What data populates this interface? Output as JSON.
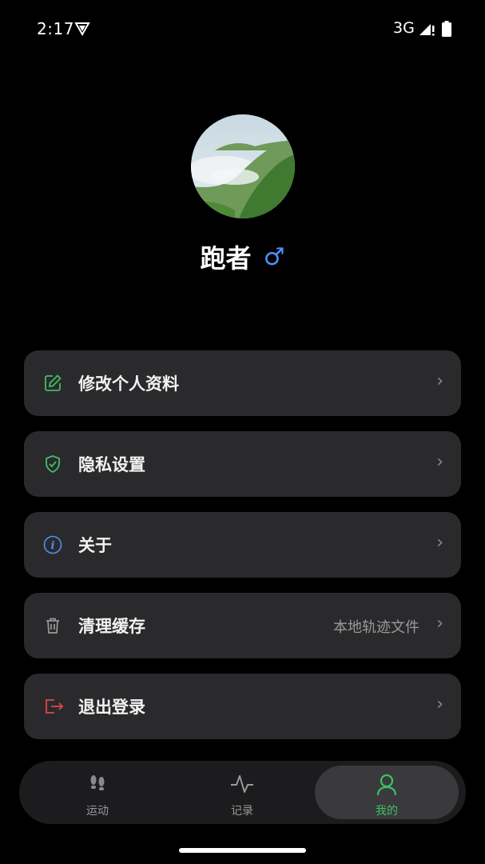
{
  "status_bar": {
    "time": "2:17",
    "network": "3G"
  },
  "profile": {
    "name": "跑者",
    "gender_symbol": "♂"
  },
  "menu": {
    "items": [
      {
        "label": "修改个人资料",
        "icon": "edit-icon",
        "color": "#3fbf6a"
      },
      {
        "label": "隐私设置",
        "icon": "shield-check-icon",
        "color": "#3fbf6a"
      },
      {
        "label": "关于",
        "icon": "info-icon",
        "color": "#4f8ff7"
      },
      {
        "label": "清理缓存",
        "sublabel": "本地轨迹文件",
        "icon": "trash-icon",
        "color": "#9a9a9a"
      },
      {
        "label": "退出登录",
        "icon": "logout-icon",
        "color": "#e0454a"
      }
    ],
    "chevron": "›"
  },
  "bottom_nav": {
    "tabs": [
      {
        "label": "运动",
        "icon": "footprints-icon"
      },
      {
        "label": "记录",
        "icon": "activity-icon"
      },
      {
        "label": "我的",
        "icon": "user-icon",
        "active": true
      }
    ]
  },
  "colors": {
    "accent": "#3fbf6a",
    "card": "#2a2a2c",
    "background": "#000000"
  }
}
